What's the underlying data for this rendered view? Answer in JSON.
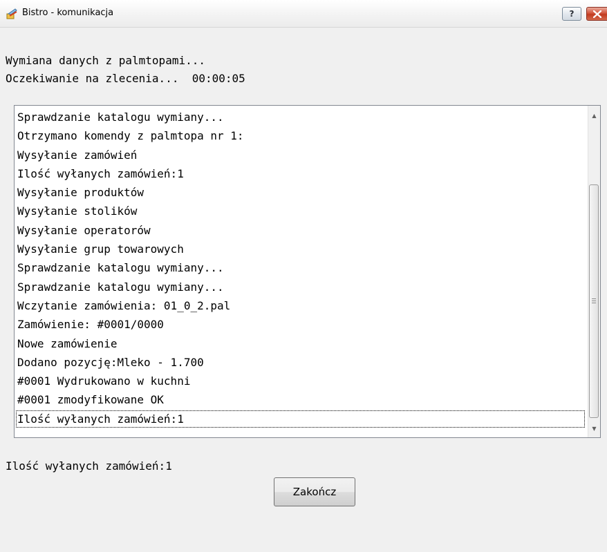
{
  "window": {
    "title": "Bistro - komunikacja",
    "help_label": "?"
  },
  "status": {
    "line1": "Wymiana danych z palmtopami...",
    "line2": "Oczekiwanie na zlecenia...  00:00:05"
  },
  "log": {
    "items": [
      "Sprawdzanie katalogu wymiany...",
      "Otrzymano komendy z palmtopa nr 1:",
      "Wysyłanie zamówień",
      "Ilość wyłanych zamówień:1",
      "Wysyłanie produktów",
      "Wysyłanie stolików",
      "Wysyłanie operatorów",
      "Wysyłanie grup towarowych",
      "Sprawdzanie katalogu wymiany...",
      "Sprawdzanie katalogu wymiany...",
      "Wczytanie zamówienia: 01_0_2.pal",
      "Zamówienie: #0001/0000",
      "Nowe zamówienie",
      "Dodano pozycję:Mleko - 1.700",
      "#0001 Wydrukowano w kuchni",
      "#0001 zmodyfikowane OK",
      "Ilość wyłanych zamówień:1"
    ],
    "selected_index": 16
  },
  "footer": {
    "status": "Ilość wyłanych zamówień:1",
    "close_label": "Zakończ"
  }
}
